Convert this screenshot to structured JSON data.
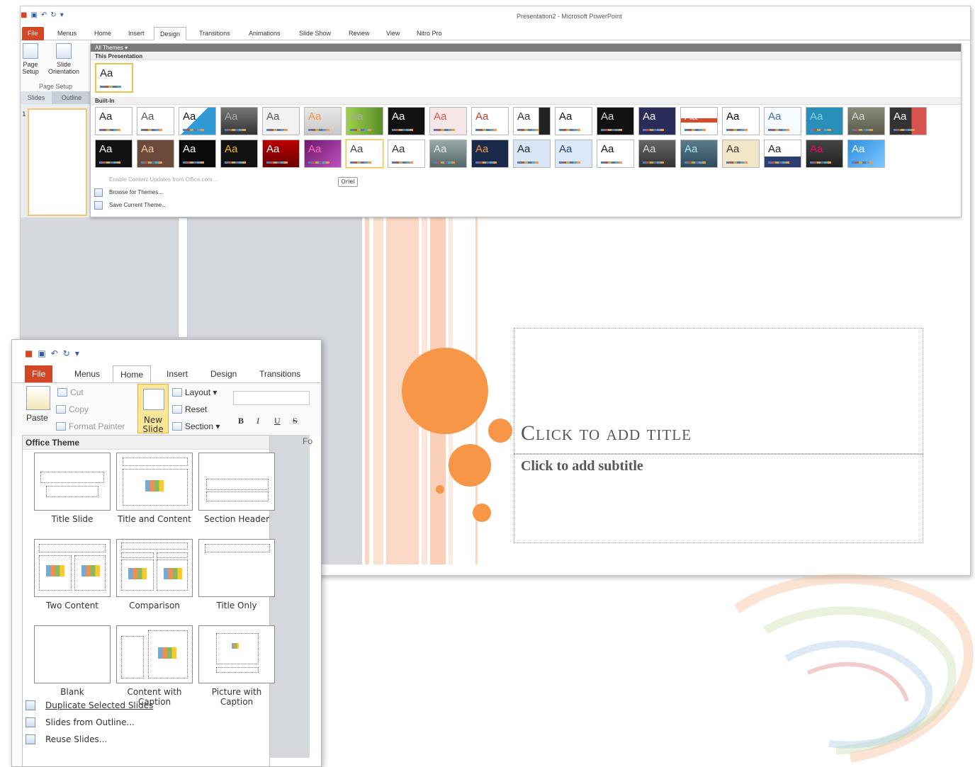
{
  "main_window": {
    "title": "Presentation2 - Microsoft PowerPoint",
    "tabs": [
      "File",
      "Menus",
      "Home",
      "Insert",
      "Design",
      "Transitions",
      "Animations",
      "Slide Show",
      "Review",
      "View",
      "Nitro Pro"
    ],
    "active_tab": "Design",
    "ribbon": {
      "page_setup_label": "Page Setup",
      "slide_orientation_label": "Slide Orientation",
      "group_label": "Page Setup"
    },
    "pane_tabs": [
      "Slides",
      "Outline"
    ],
    "thumbnail_number": "1"
  },
  "gallery": {
    "filter": "All Themes ▾",
    "this_presentation": "This Presentation",
    "built_in": "Built-In",
    "theme_glyph": "Aa",
    "tooltip": "Oriel",
    "menu": {
      "enable_updates": "Enable Content Updates from Office.com...",
      "browse": "Browse for Themes...",
      "save": "Save Current Theme..."
    }
  },
  "slide": {
    "title": "Click to add title",
    "subtitle": "Click to add subtitle",
    "accent_color": "#f79646"
  },
  "second_window": {
    "tabs": [
      "File",
      "Menus",
      "Home",
      "Insert",
      "Design",
      "Transitions"
    ],
    "active_tab": "Home",
    "clipboard": {
      "paste": "Paste",
      "cut": "Cut",
      "copy": "Copy",
      "format_painter": "Format Painter"
    },
    "new_slide": "New Slide",
    "slides_group": {
      "layout": "Layout",
      "reset": "Reset",
      "section": "Section"
    },
    "font_buttons": [
      "B",
      "I",
      "U",
      "S"
    ],
    "font_group_partial": "Fo",
    "dropdown": {
      "header": "Office Theme",
      "layouts": [
        "Title Slide",
        "Title and Content",
        "Section Header",
        "Two Content",
        "Comparison",
        "Title Only",
        "Blank",
        "Content with Caption",
        "Picture with Caption"
      ],
      "menu": [
        "Duplicate Selected Slides",
        "Slides from Outline...",
        "Reuse Slides..."
      ]
    }
  }
}
